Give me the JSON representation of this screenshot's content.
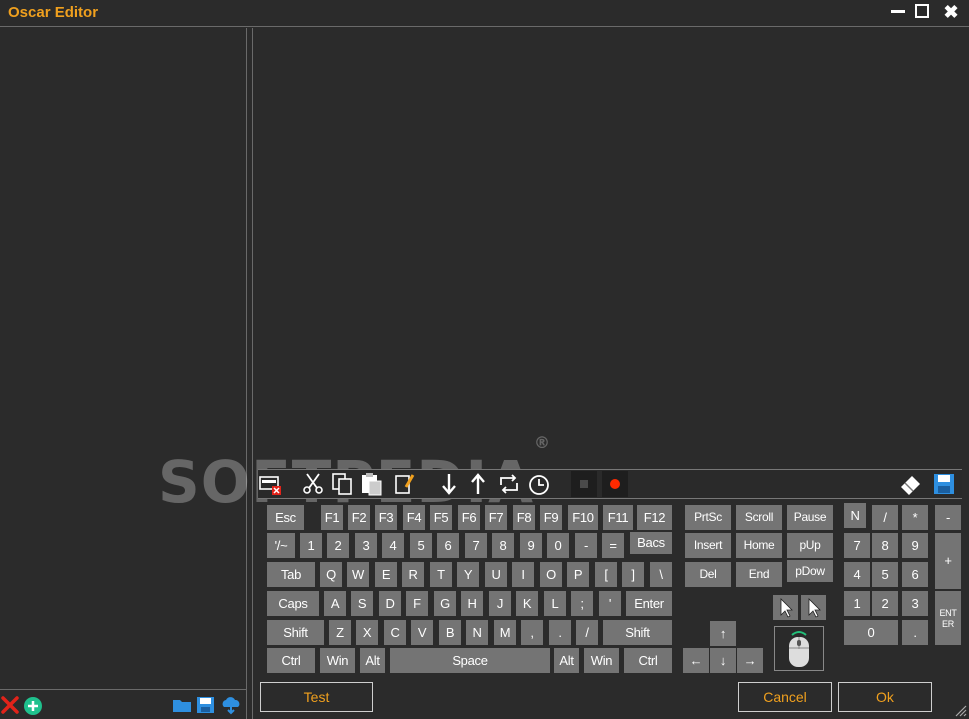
{
  "window": {
    "title": "Oscar Editor",
    "minimize_icon": "minimize-icon",
    "maximize_icon": "maximize-icon",
    "close_icon": "close-icon"
  },
  "left_panel": {
    "bottom_icons": [
      "delete-icon",
      "add-icon",
      "open-folder-icon",
      "save-icon",
      "cloud-icon"
    ]
  },
  "toolbar": {
    "icons": [
      "clear-icon",
      "cut-icon",
      "copy-icon",
      "paste-icon",
      "edit-icon",
      "down-arrow-icon",
      "up-arrow-icon",
      "loop-icon",
      "timer-icon",
      "stop-icon",
      "record-icon",
      "eraser-icon",
      "save-icon"
    ]
  },
  "watermark": {
    "text": "SOFTPEDIA",
    "mark": "®"
  },
  "keyboard": {
    "main": {
      "row1": [
        "Esc",
        "F1",
        "F2",
        "F3",
        "F4",
        "F5",
        "F6",
        "F7",
        "F8",
        "F9",
        "F10",
        "F11",
        "F12"
      ],
      "row2": [
        "'/~",
        "1",
        "2",
        "3",
        "4",
        "5",
        "6",
        "7",
        "8",
        "9",
        "0",
        "-",
        "=",
        "Bacs"
      ],
      "row3": [
        "Tab",
        "Q",
        "W",
        "E",
        "R",
        "T",
        "Y",
        "U",
        "I",
        "O",
        "P",
        "[",
        "]",
        "\\"
      ],
      "row4": [
        "Caps",
        "A",
        "S",
        "D",
        "F",
        "G",
        "H",
        "J",
        "K",
        "L",
        ";",
        "'",
        "Enter"
      ],
      "row5": [
        "Shift",
        "Z",
        "X",
        "C",
        "V",
        "B",
        "N",
        "M",
        ",",
        ".",
        "/",
        "Shift"
      ],
      "row6": [
        "Ctrl",
        "Win",
        "Alt",
        "Space",
        "Alt",
        "Win",
        "Ctrl"
      ]
    },
    "nav": {
      "row1": [
        "PrtSc",
        "Scroll",
        "Pause"
      ],
      "row2": [
        "Insert",
        "Home",
        "pUp"
      ],
      "row3": [
        "Del",
        "End",
        "pDow"
      ],
      "arrows": [
        "↑",
        "←",
        "↓",
        "→"
      ]
    },
    "numpad": {
      "row1": [
        "N",
        "/",
        "*",
        "-"
      ],
      "row2": [
        "7",
        "8",
        "9",
        "+"
      ],
      "row3": [
        "4",
        "5",
        "6"
      ],
      "row4": [
        "1",
        "2",
        "3",
        "ENT ER"
      ],
      "row5": [
        "0",
        "."
      ]
    },
    "mouse_icons": [
      "left-click-icon",
      "right-click-icon",
      "mouse-icon"
    ]
  },
  "buttons": {
    "test": "Test",
    "cancel": "Cancel",
    "ok": "Ok"
  },
  "colors": {
    "accent": "#f0a01e",
    "background": "#2b2b2b",
    "key": "#747474",
    "record": "#ff2a00"
  }
}
